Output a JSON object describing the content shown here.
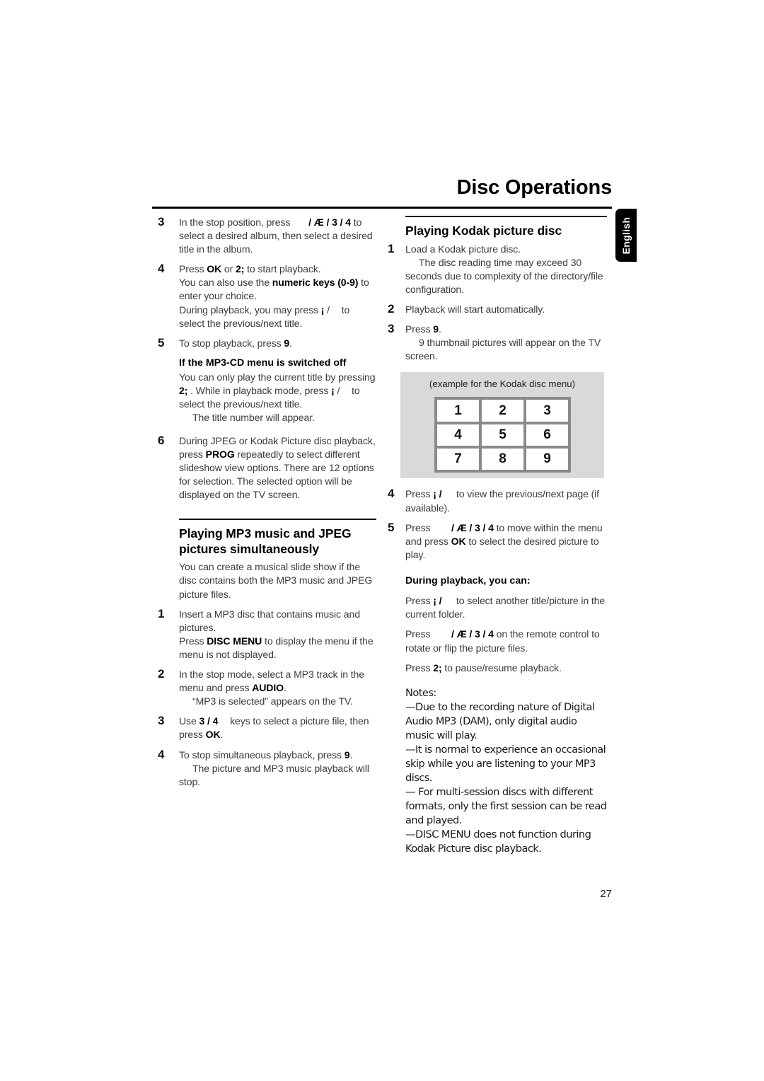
{
  "header": {
    "title": "Disc Operations",
    "language_tab": "English"
  },
  "page_number": "27",
  "left_column": {
    "steps": [
      {
        "num": "3",
        "lines": [
          "In the stop position, press",
          "/ Æ / 3 / 4 to select a desired album, then select a desired title in the album."
        ]
      },
      {
        "num": "4",
        "lines": [
          "Press OK or 2; to start playback.",
          "You can also use the numeric keys (0-9) to enter your choice.",
          "During playback, you may press ¡ / to select the previous/next title."
        ]
      },
      {
        "num": "5",
        "lines": [
          "To stop playback, press 9."
        ]
      }
    ],
    "mp3cd_subhead": "If the MP3-CD menu is switched off",
    "mp3cd_body_1": "You can only play the current title by pressing",
    "mp3cd_body_2": ". While in playback mode, press",
    "mp3cd_body_3": "to select the previous/next title.",
    "mp3cd_note": "The title number will appear.",
    "step6": {
      "num": "6",
      "text": "During JPEG or Kodak Picture disc playback, press PROG repeatedly to select different slideshow view options. There are 12 options for selection. The selected option will be displayed on the TV screen."
    },
    "section2": {
      "heading_line1": "Playing MP3 music and JPEG",
      "heading_line2": "pictures simultaneously",
      "intro": "You can create a musical slide show if the disc contains both the MP3 music and JPEG picture files.",
      "steps": [
        {
          "num": "1",
          "line1": "Insert a MP3 disc that contains music and pictures.",
          "line2_a": "Press ",
          "line2_b": "DISC MENU",
          "line2_c": " to display the menu if the menu is not displayed."
        },
        {
          "num": "2",
          "line1_a": "In the stop mode, select a MP3 track in the menu and press ",
          "line1_b": "AUDIO",
          "line1_c": ".",
          "note": "“MP3 is selected” appears on the TV."
        },
        {
          "num": "3",
          "line_a": "Use ",
          "g1": "3",
          "sep": " / ",
          "g2": "4",
          "line_b": " keys to select a picture file, then press ",
          "line_c": "OK",
          "line_d": "."
        },
        {
          "num": "4",
          "line1_a": "To stop simultaneous playback, press ",
          "line1_g": "9",
          "line1_b": ".",
          "note": "The picture and MP3 music playback will stop."
        }
      ]
    }
  },
  "right_column": {
    "heading": "Playing Kodak picture disc",
    "steps": [
      {
        "num": "1",
        "line1": "Load a Kodak picture disc.",
        "note": "The disc reading time may exceed 30 seconds due to complexity of the directory/file configuration."
      },
      {
        "num": "2",
        "line1": "Playback will start automatically."
      },
      {
        "num": "3",
        "line1_a": "Press ",
        "line1_g": "9",
        "line1_b": ".",
        "note": "9 thumbnail pictures will appear on the TV screen."
      }
    ],
    "figure": {
      "caption": "(example for the Kodak disc menu)",
      "cells": [
        "1",
        "2",
        "3",
        "4",
        "5",
        "6",
        "7",
        "8",
        "9"
      ],
      "background_color": "#d9d9d9",
      "frame_color": "#8a8a8a",
      "cell_color": "#ffffff"
    },
    "steps_after": [
      {
        "num": "4",
        "line_a": "Press ",
        "g1": "¡",
        "sep": " / ",
        "line_b": " to view the previous/next page (if available)."
      },
      {
        "num": "5",
        "line_a": "Press ",
        "g1": "",
        "sep1": " / ",
        "g2": "Æ",
        "sep2": " / ",
        "g3": "3",
        "sep3": " / ",
        "g4": "4",
        "line_b": " to move within the menu and press ",
        "line_c": "OK",
        "line_d": " to select the desired picture to play."
      }
    ],
    "during_playback": {
      "heading": "During playback, you can:",
      "p1_a": "Press ",
      "p1_g": "¡",
      "p1_sep": " / ",
      "p1_b": " to select another title/picture in the current folder.",
      "p2_a": "Press ",
      "p2_g1": "",
      "p2_s1": " / ",
      "p2_g2": "Æ",
      "p2_s2": " / ",
      "p2_g3": "3",
      "p2_s3": " / ",
      "p2_g4": "4",
      "p2_b": " on the remote control to rotate or flip the picture files.",
      "p3_a": "Press ",
      "p3_g": "2;",
      "p3_b": " to pause/resume playback."
    },
    "notes": {
      "label": "Notes:",
      "items": [
        "—Due to the recording nature of Digital Audio MP3 (DAM), only digital audio music will play.",
        "—It is normal to experience an occasional  skip while you are listening to your MP3 discs.",
        "— For multi-session discs with different formats, only the first session can be read and played.",
        "—DISC MENU does not function during Kodak Picture disc playback."
      ]
    }
  }
}
